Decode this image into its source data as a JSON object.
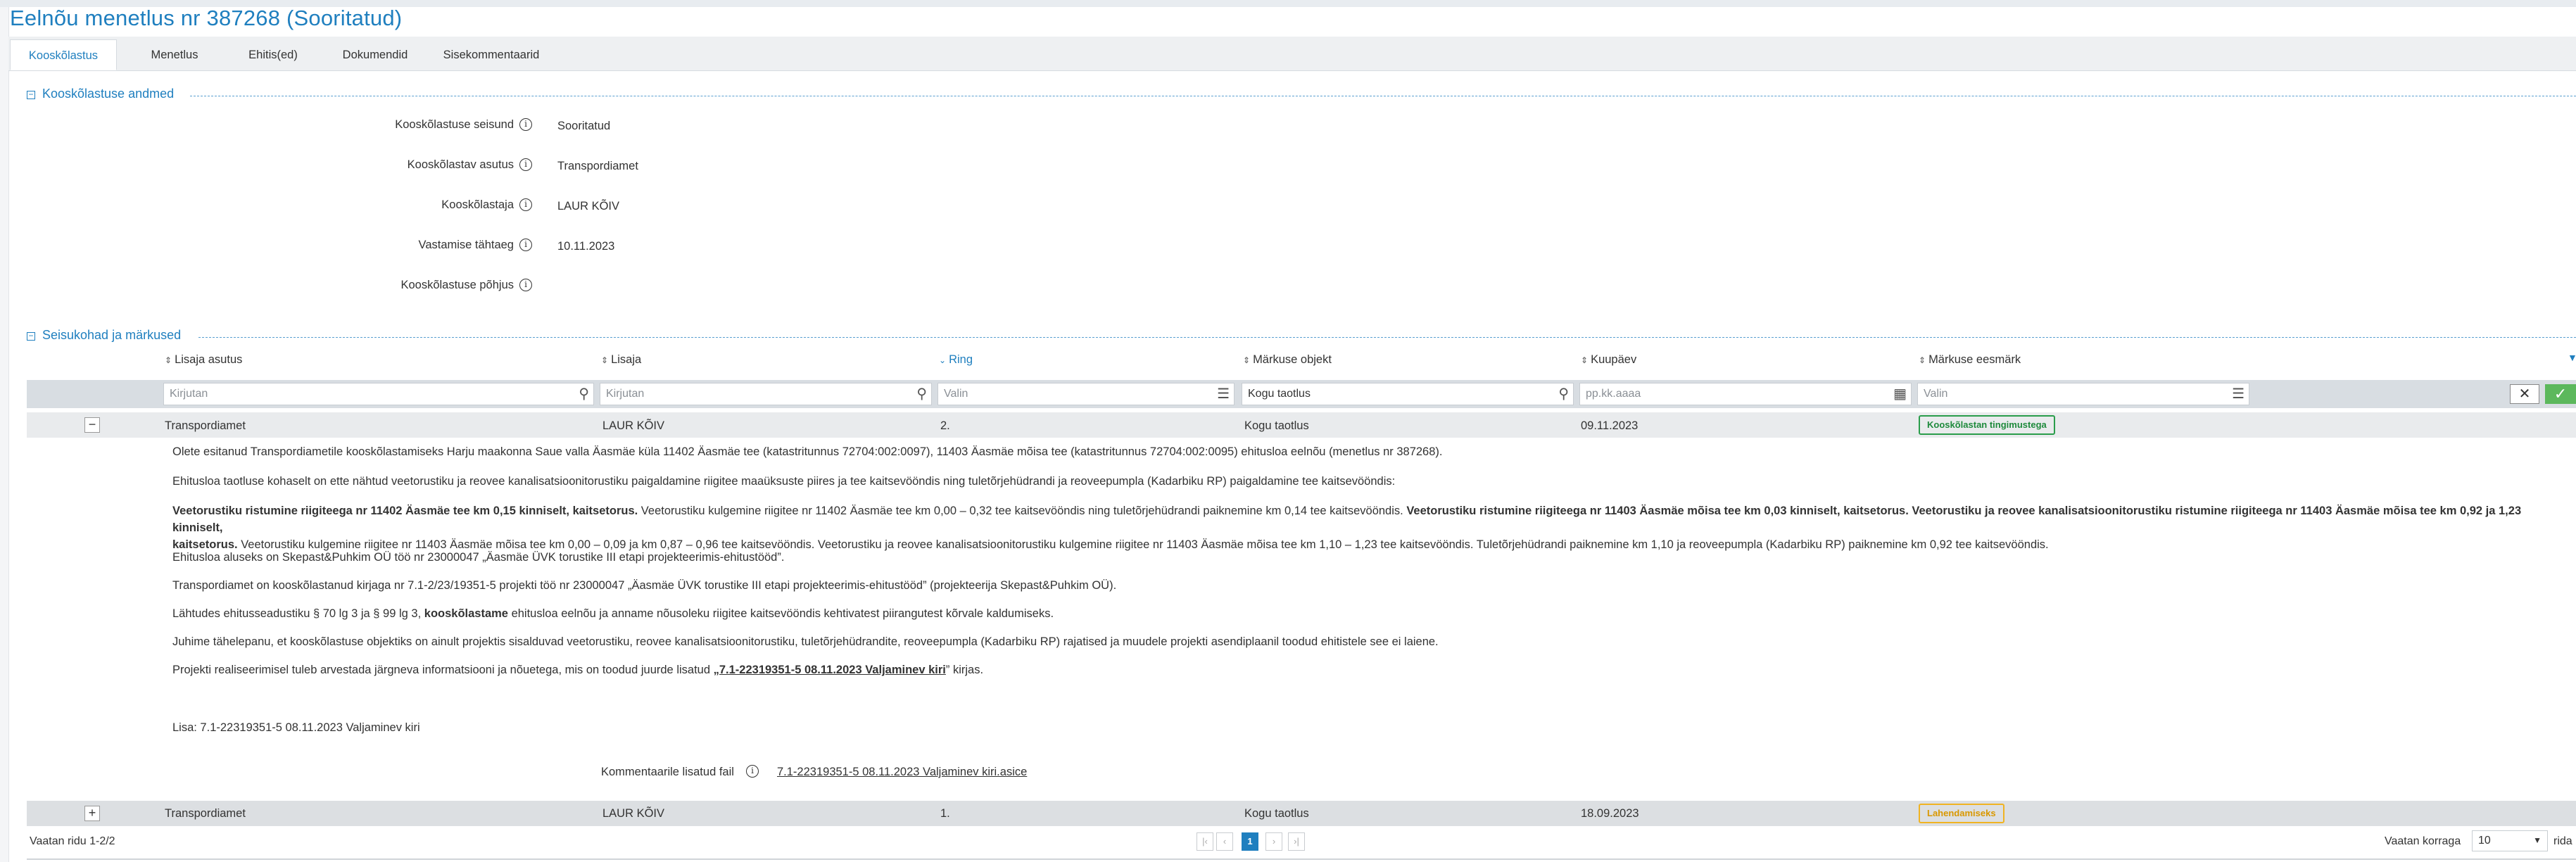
{
  "title": "Eelnõu menetlus nr 387268 (Sooritatud)",
  "tabs": [
    "Kooskõlastus",
    "Menetlus",
    "Ehitis(ed)",
    "Dokumendid",
    "Sisekommentaarid"
  ],
  "section1": {
    "title": "Kooskõlastuse andmed",
    "fields": [
      {
        "label": "Kooskõlastuse seisund",
        "value": "Sooritatud"
      },
      {
        "label": "Kooskõlastav asutus",
        "value": "Transpordiamet"
      },
      {
        "label": "Kooskõlastaja",
        "value": "LAUR KÕIV"
      },
      {
        "label": "Vastamise tähtaeg",
        "value": "10.11.2023"
      },
      {
        "label": "Kooskõlastuse põhjus",
        "value": ""
      }
    ]
  },
  "section2": {
    "title": "Seisukohad ja märkused",
    "columns": [
      "Lisaja asutus",
      "Lisaja",
      "Ring",
      "Märkuse objekt",
      "Kuupäev",
      "Märkuse eesmärk"
    ],
    "filters": {
      "agency": "Kirjutan",
      "author": "Kirjutan",
      "round": "Valin",
      "object": "Kogu taotlus",
      "date": "pp.kk.aaaa",
      "purpose": "Valin"
    }
  },
  "rows": [
    {
      "toggle": "−",
      "agency": "Transpordiamet",
      "author": "LAUR KÕIV",
      "round": "2.",
      "object": "Kogu taotlus",
      "date": "09.11.2023",
      "purpose": "Kooskõlastan tingimustega"
    },
    {
      "toggle": "+",
      "agency": "Transpordiamet",
      "author": "LAUR KÕIV",
      "round": "1.",
      "object": "Kogu taotlus",
      "date": "18.09.2023",
      "purpose": "Lahendamiseks"
    }
  ],
  "comment": {
    "p1": "Olete esitanud Transpordiametile kooskõlastamiseks Harju maakonna Saue valla Äasmäe küla 11402 Äasmäe tee (katastritunnus 72704:002:0097), 11403 Äasmäe mõisa tee (katastritunnus 72704:002:0095) ehitusloa eelnõu (menetlus nr 387268).",
    "p2": "Ehitusloa taotluse kohaselt on ette nähtud veetorustiku ja reovee kanalisatsioonitorustiku paigaldamine riigitee maaüksuste piires ja tee kaitsevööndis ning tuletõrjehüdrandi ja reoveepumpla (Kadarbiku RP) paigaldamine tee kaitsevööndis:",
    "p3_b1": "Veetorustiku ristumine riigiteega nr 11402 Äasmäe tee km 0,15 kinniselt, kaitsetorus.",
    "p3_t1": " Veetorustiku kulgemine riigitee nr 11402 Äasmäe tee km 0,00 – 0,32 tee kaitsevööndis ning tuletõrjehüdrandi paiknemine km 0,14 tee kaitsevööndis. ",
    "p3_b2": "Veetorustiku ristumine riigiteega nr 11403 Äasmäe mõisa tee km 0,03 kinniselt, kaitsetorus. Veetorustiku ja reovee kanalisatsioonitorustiku ristumine riigiteega nr 11403 Äasmäe mõisa tee km 0,92 ja 1,23 kinniselt,",
    "p3_b3": "kaitsetorus.",
    "p3_t2": " Veetorustiku kulgemine riigitee nr 11403 Äasmäe mõisa tee km 0,00 – 0,09 ja km 0,87 – 0,96 tee kaitsevööndis. Veetorustiku ja reovee kanalisatsioonitorustiku kulgemine riigitee nr 11403 Äasmäe mõisa tee km 1,10 – 1,23 tee kaitsevööndis. Tuletõrjehüdrandi paiknemine km 1,10 ja reoveepumpla (Kadarbiku RP) paiknemine km 0,92 tee kaitsevööndis.",
    "p4": "Ehitusloa aluseks on Skepast&Puhkim OÜ töö nr 23000047 „Äasmäe ÜVK torustike III etapi projekteerimis-ehitustööd”.",
    "p5": "Transpordiamet on kooskõlastanud kirjaga nr 7.1-2/23/19351-5 projekti töö nr 23000047 „Äasmäe ÜVK torustike III etapi projekteerimis-ehitustööd” (projekteerija Skepast&Puhkim OÜ).",
    "p6_t1": "Lähtudes ehitusseadustiku § 70 lg 3 ja § 99 lg 3, ",
    "p6_b1": "kooskõlastame",
    "p6_t2": " ehitusloa eelnõu ja anname nõusoleku riigitee kaitsevööndis kehtivatest piirangutest kõrvale kaldumiseks.",
    "p7": "Juhime tähelepanu, et kooskõlastuse objektiks on ainult projektis sisalduvad veetorustiku, reovee kanalisatsioonitorustiku, tuletõrjehüdrandite, reoveepumpla (Kadarbiku RP) rajatised ja muudele projekti asendiplaanil toodud ehitistele see ei laiene.",
    "p8_t1": "Projekti realiseerimisel tuleb arvestada järgneva informatsiooni ja nõuetega, mis on toodud juurde lisatud ",
    "p8_link": "„7.1-22319351-5 08.11.2023 Valjaminev kiri",
    "p8_t2": "” kirjas.",
    "p9": "Lisa: 7.1-22319351-5 08.11.2023 Valjaminev kiri",
    "file_label": "Kommentaarile lisatud fail",
    "file_link": "7.1-22319351-5 08.11.2023 Valjaminev kiri.asice"
  },
  "footer": {
    "count": "Vaatan ridu 1-2/2",
    "pages": [
      "|‹",
      "‹",
      "1",
      "›",
      "›|"
    ],
    "pagesize_label": "Vaatan korraga",
    "pagesize": "10",
    "trailing": "rida"
  },
  "colors": {
    "accent": "#1f7fbf",
    "green": "#2a9d4b",
    "yellow": "#f0b323"
  }
}
